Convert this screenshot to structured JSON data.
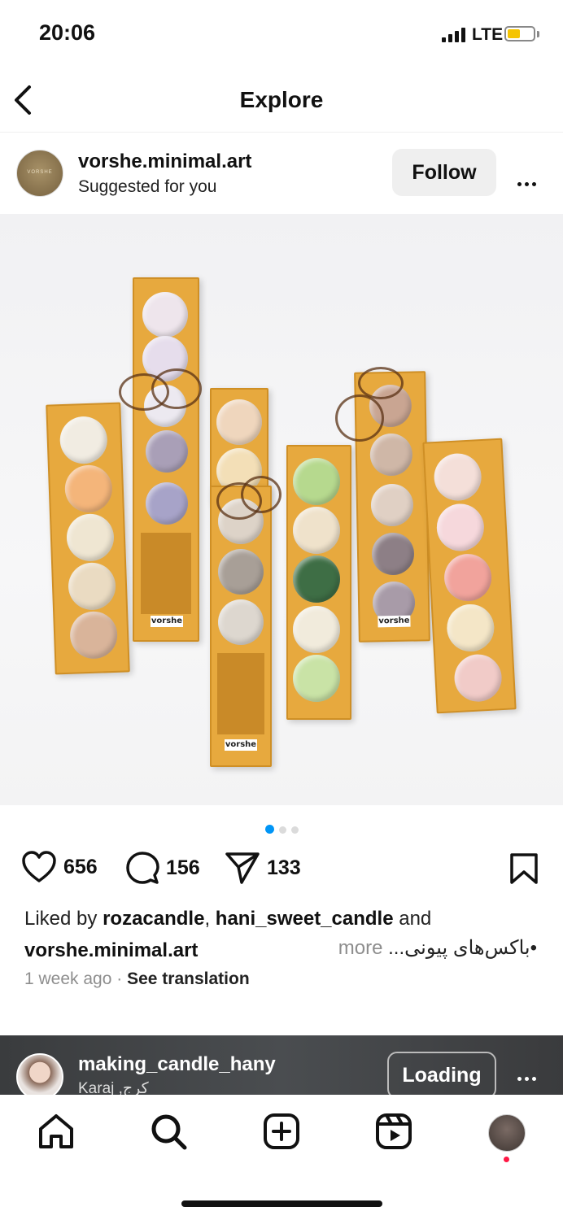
{
  "status_bar": {
    "time": "20:06",
    "network": "LTE"
  },
  "nav": {
    "title": "Explore"
  },
  "post": {
    "username": "vorshe.minimal.art",
    "subtitle": "Suggested for you",
    "avatar_text": "VORSHE",
    "follow_label": "Follow",
    "image_box_label": "vorshe",
    "carousel_count": 3,
    "carousel_active": 1,
    "likes": "656",
    "comments": "156",
    "shares": "133",
    "liked_by_prefix": "Liked by",
    "liked_by_user1": "rozacandle",
    "liked_by_sep": ",",
    "liked_by_user2": "hani_sweet_candle",
    "liked_by_suffix": "and",
    "caption_user": "vorshe.minimal.art",
    "caption_more": "more",
    "caption_text": "•باکس‌های پیونی...",
    "time_ago": "1 week ago",
    "meta_sep": "·",
    "see_translation": "See translation"
  },
  "next_post": {
    "username": "making_candle_hany",
    "location": "Karaj ,کرج",
    "button_label": "Loading"
  },
  "tabs": [
    {
      "name": "home",
      "icon": "home-icon"
    },
    {
      "name": "search",
      "icon": "search-icon"
    },
    {
      "name": "create",
      "icon": "plus-square-icon"
    },
    {
      "name": "reels",
      "icon": "reels-icon"
    },
    {
      "name": "profile",
      "icon": "profile-avatar"
    }
  ],
  "colors": {
    "accent": "#0095f6",
    "box": "#e7a93e",
    "notification": "#ff1744"
  }
}
